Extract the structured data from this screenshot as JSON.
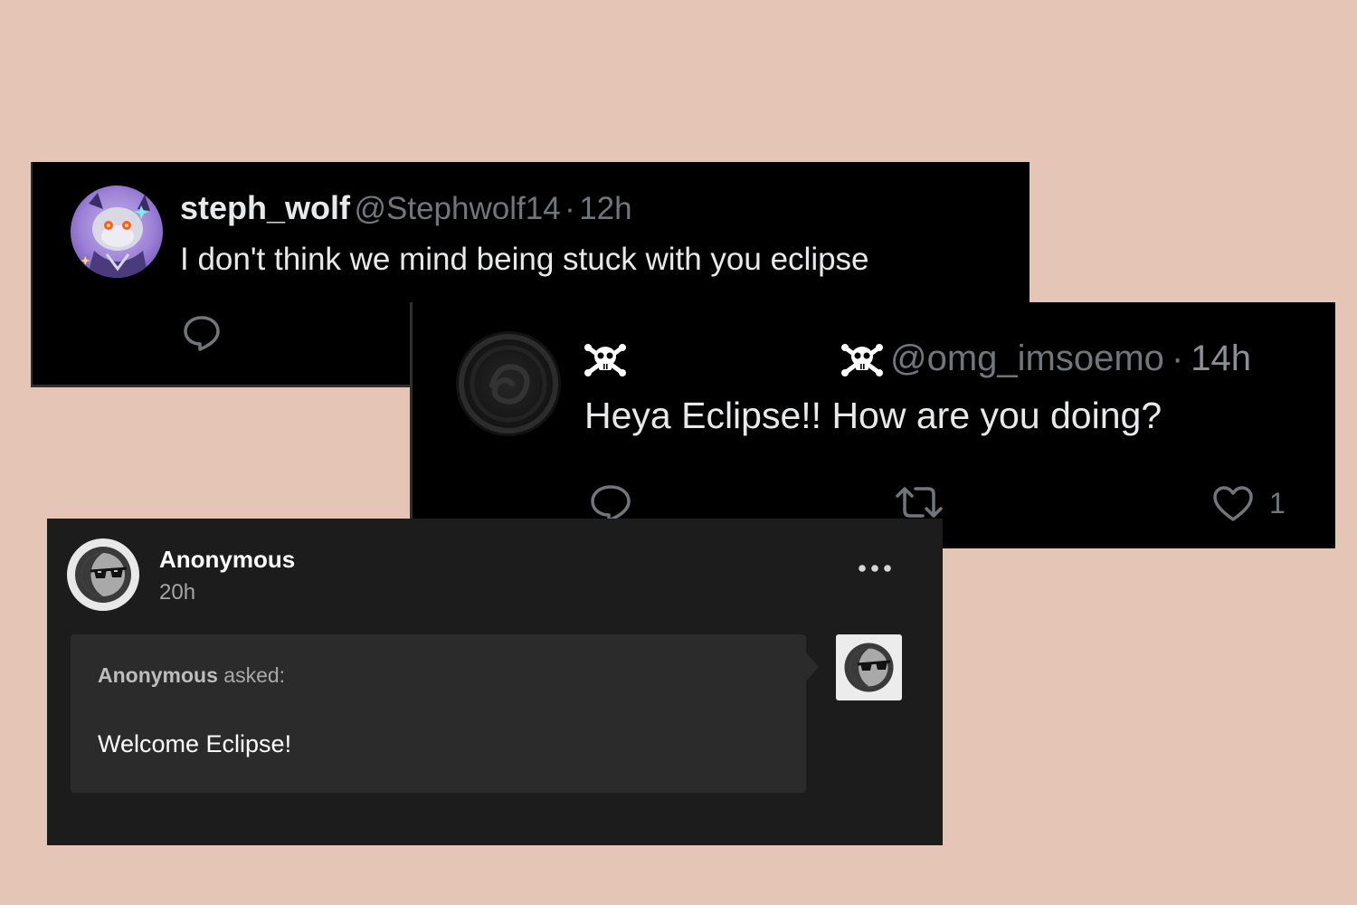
{
  "tweet1": {
    "display_name": "steph_wolf",
    "handle": "@Stephwolf14",
    "separator": "·",
    "time": "12h",
    "text": "I don't think we mind being stuck with you eclipse",
    "avatar_icon": "wolf-character-avatar",
    "colors": {
      "background": "#000000",
      "text": "#e7e9ea",
      "muted": "#71767b"
    }
  },
  "tweet2": {
    "display_name_icon": "skull-crossbones-icon",
    "handle": "@omg_imsoemo",
    "separator": "·",
    "time": "14h",
    "text": "Heya Eclipse!! How are you doing?",
    "like_count": "1",
    "avatar_icon": "dark-swirl-avatar",
    "colors": {
      "background": "#000000",
      "text": "#e7e9ea",
      "muted": "#71767b"
    }
  },
  "ask": {
    "author": "Anonymous",
    "time": "20h",
    "asker": "Anonymous",
    "asked_label": " asked:",
    "question": "Welcome Eclipse!",
    "avatar_icon": "anonymous-sunglasses-avatar",
    "colors": {
      "background": "#1c1c1c",
      "bubble": "#2b2b2b",
      "text": "#ffffff"
    }
  },
  "page": {
    "background": "#e4c5b6"
  }
}
